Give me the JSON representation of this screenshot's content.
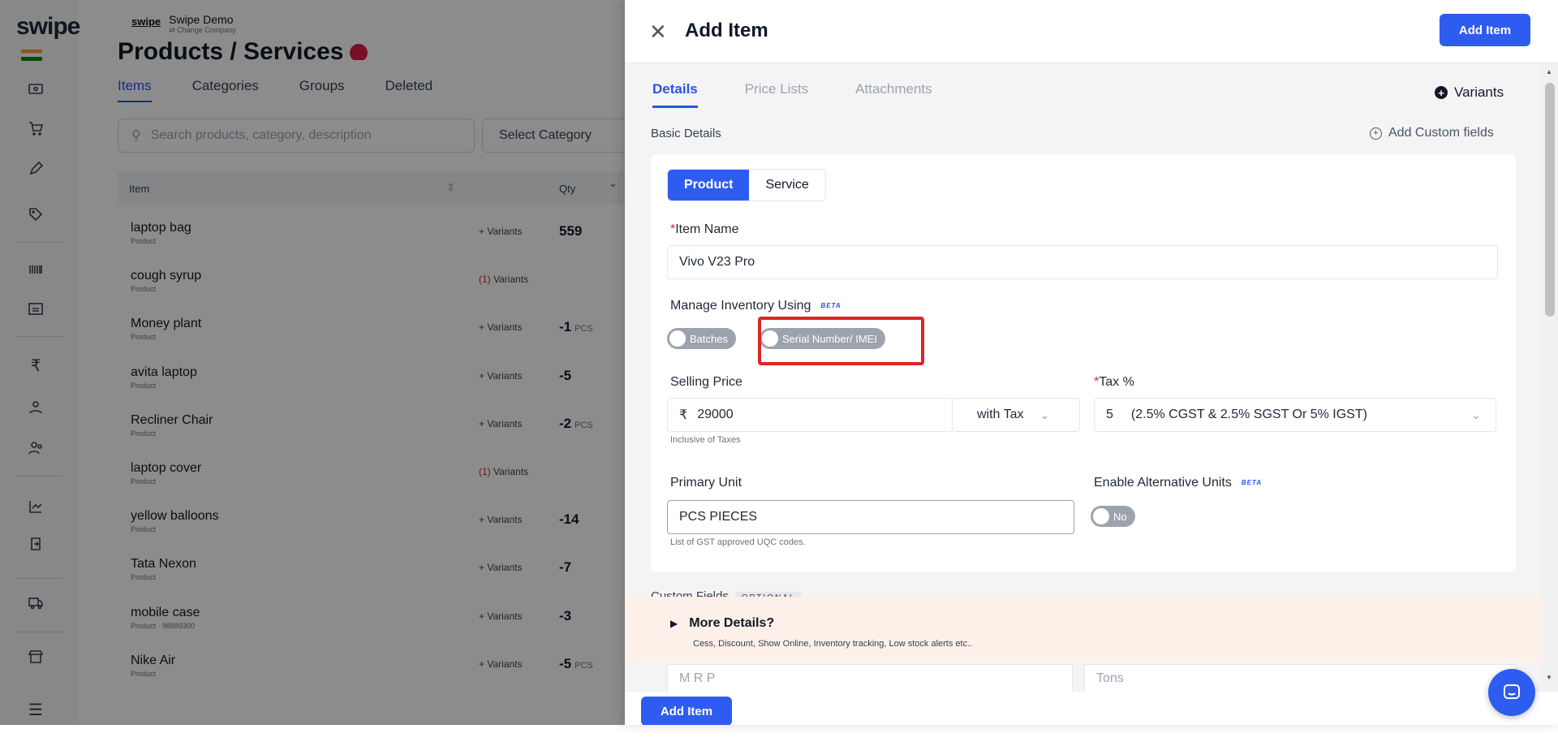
{
  "background": {
    "logo": "swipe",
    "company": {
      "logo_text": "swipe",
      "name": "Swipe Demo",
      "sub": "⇄ Change Company"
    },
    "page_title": "Products / Services",
    "tabs": [
      "Items",
      "Categories",
      "Groups",
      "Deleted"
    ],
    "search_placeholder": "Search products, category, description",
    "select_category": "Select Category",
    "table_headers": {
      "item": "Item",
      "qty": "Qty"
    },
    "rows": [
      {
        "name": "laptop bag",
        "type": "Product",
        "variants": "+ Variants",
        "qty": "559",
        "unit": ""
      },
      {
        "name": "cough syrup",
        "type": "Product",
        "variants_count": "(1)",
        "variants": "Variants",
        "qty": "",
        "unit": ""
      },
      {
        "name": "Money plant",
        "type": "Product",
        "variants": "+ Variants",
        "qty": "-1",
        "unit": "PCS"
      },
      {
        "name": "avita laptop",
        "type": "Product",
        "variants": "+ Variants",
        "qty": "-5",
        "unit": ""
      },
      {
        "name": "Recliner Chair",
        "type": "Product",
        "variants": "+ Variants",
        "qty": "-2",
        "unit": "PCS"
      },
      {
        "name": "laptop cover",
        "type": "Product",
        "variants_count": "(1)",
        "variants": "Variants",
        "qty": "",
        "unit": ""
      },
      {
        "name": "yellow balloons",
        "type": "Product",
        "variants": "+ Variants",
        "qty": "-14",
        "unit": ""
      },
      {
        "name": "Tata Nexon",
        "type": "Product",
        "variants": "+ Variants",
        "qty": "-7",
        "unit": ""
      },
      {
        "name": "mobile case",
        "type": "Product · 98889300",
        "variants": "+ Variants",
        "qty": "-3",
        "unit": ""
      },
      {
        "name": "Nike Air",
        "type": "Product",
        "variants": "+ Variants",
        "qty": "-5",
        "unit": "PCS"
      }
    ]
  },
  "drawer": {
    "title": "Add Item",
    "add_item_button": "Add Item",
    "tabs": [
      "Details",
      "Price Lists",
      "Attachments"
    ],
    "variants_label": "Variants",
    "basic_details_label": "Basic Details",
    "add_custom_fields": "Add Custom fields",
    "type_toggle": [
      "Product",
      "Service"
    ],
    "item_name_label": "Item Name",
    "item_name_value": "Vivo V23 Pro",
    "manage_inventory_label": "Manage Inventory Using",
    "beta": "BETA",
    "inventory_options": [
      "Batches",
      "Serial Number/ IMEI"
    ],
    "selling_price_label": "Selling Price",
    "currency": "₹",
    "selling_price_value": "29000",
    "with_tax": "with Tax",
    "inclusive_hint": "Inclusive of Taxes",
    "tax_label": "Tax %",
    "tax_value": "5",
    "tax_desc": "(2.5% CGST & 2.5% SGST Or 5% IGST)",
    "primary_unit_label": "Primary Unit",
    "primary_unit_value": "PCS PIECES",
    "uqc_hint": "List of GST approved UQC codes.",
    "alt_units_label": "Enable Alternative Units",
    "alt_units_toggle": "No",
    "custom_fields_label": "Custom Fields",
    "optional": "OPTIONAL",
    "more_details_title": "More Details?",
    "more_details_sub": "Cess, Discount, Show Online, Inventory tracking, Low stock alerts etc..",
    "mrp_placeholder": "M R P",
    "tons_placeholder": "Tons",
    "footer_button": "Add Item"
  },
  "colors": {
    "accent": "#2f5cf0",
    "highlight": "#dc2626",
    "required": "#e11d48"
  }
}
